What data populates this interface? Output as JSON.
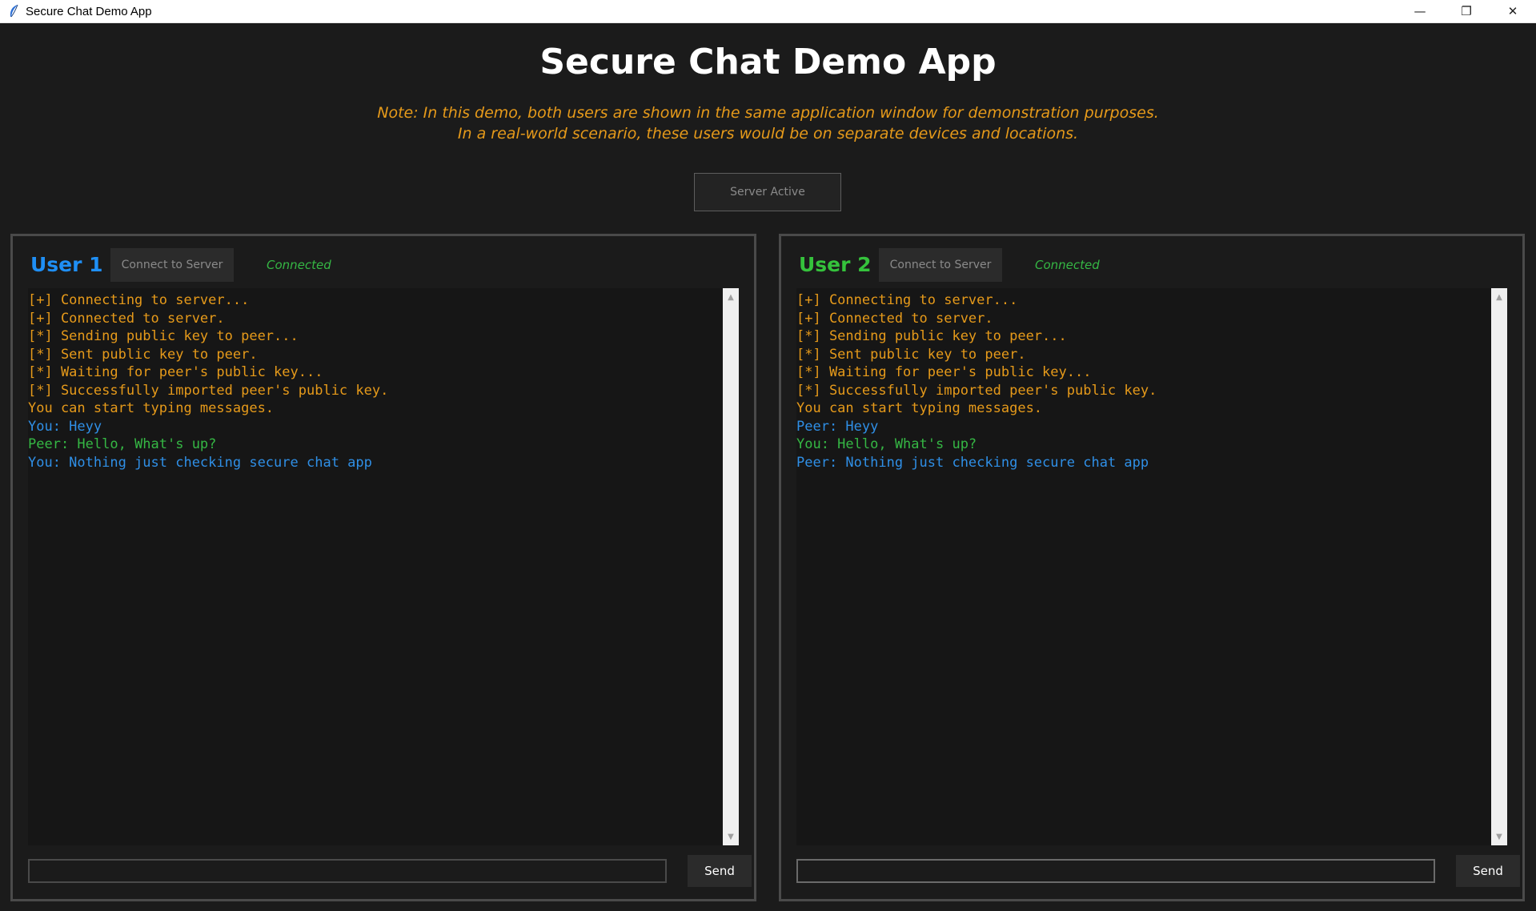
{
  "window": {
    "title": "Secure Chat Demo App",
    "controls": {
      "minimize": "—",
      "restore": "❐",
      "close": "✕"
    }
  },
  "header": {
    "title": "Secure Chat Demo App",
    "note_line1": "Note: In this demo, both users are shown in the same application window for demonstration purposes.",
    "note_line2": "In a real-world scenario, these users would be on separate devices and locations.",
    "server_button": "Server Active"
  },
  "colors": {
    "background": "#1b1b1b",
    "system_text": "#e69a1a",
    "you_text": "#2f8fe6",
    "peer_text": "#35b744",
    "user1_accent": "#1f8ff5",
    "user2_accent": "#35c23c"
  },
  "user1": {
    "label": "User 1",
    "connect_button": "Connect to Server",
    "status": "Connected",
    "send_button": "Send",
    "input_value": "",
    "messages": [
      {
        "type": "system",
        "text": "[+] Connecting to server..."
      },
      {
        "type": "system",
        "text": "[+] Connected to server."
      },
      {
        "type": "system",
        "text": "[*] Sending public key to peer..."
      },
      {
        "type": "system",
        "text": "[*] Sent public key to peer."
      },
      {
        "type": "system",
        "text": "[*] Waiting for peer's public key..."
      },
      {
        "type": "system",
        "text": "[*] Successfully imported peer's public key."
      },
      {
        "type": "system",
        "text": "You can start typing messages."
      },
      {
        "type": "you",
        "text": "You: Heyy"
      },
      {
        "type": "peer",
        "text": "Peer: Hello, What's up?"
      },
      {
        "type": "you",
        "text": "You: Nothing just checking secure chat app"
      }
    ]
  },
  "user2": {
    "label": "User 2",
    "connect_button": "Connect to Server",
    "status": "Connected",
    "send_button": "Send",
    "input_value": "",
    "messages": [
      {
        "type": "system",
        "text": "[+] Connecting to server..."
      },
      {
        "type": "system",
        "text": "[+] Connected to server."
      },
      {
        "type": "system",
        "text": "[*] Sending public key to peer..."
      },
      {
        "type": "system",
        "text": "[*] Sent public key to peer."
      },
      {
        "type": "system",
        "text": "[*] Waiting for peer's public key..."
      },
      {
        "type": "system",
        "text": "[*] Successfully imported peer's public key."
      },
      {
        "type": "system",
        "text": "You can start typing messages."
      },
      {
        "type": "you",
        "text": "Peer: Heyy"
      },
      {
        "type": "peer",
        "text": "You: Hello, What's up?"
      },
      {
        "type": "you",
        "text": "Peer: Nothing just checking secure chat app"
      }
    ]
  }
}
